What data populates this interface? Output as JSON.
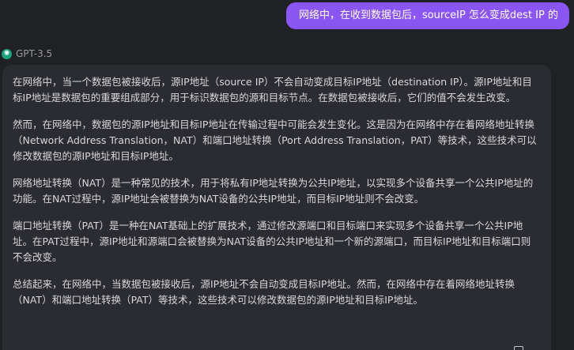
{
  "user_message": "网络中，在收到数据包后，sourceIP 怎么变成dest IP 的",
  "model": {
    "name": "GPT-3.5",
    "icon": "openai-icon"
  },
  "answer": {
    "paragraphs": [
      "在网络中，当一个数据包被接收后，源IP地址（source IP）不会自动变成目标IP地址（destination IP）。源IP地址和目标IP地址是数据包的重要组成部分，用于标识数据包的源和目标节点。在数据包被接收后，它们的值不会发生改变。",
      "然而，在网络中，数据包的源IP地址和目标IP地址在传输过程中可能会发生变化。这是因为在网络中存在着网络地址转换（Network Address Translation，NAT）和端口地址转换（Port Address Translation，PAT）等技术，这些技术可以修改数据包的源IP地址和目标IP地址。",
      "网络地址转换（NAT）是一种常见的技术，用于将私有IP地址转换为公共IP地址，以实现多个设备共享一个公共IP地址的功能。在NAT过程中，源IP地址会被替换为NAT设备的公共IP地址，而目标IP地址则不会改变。",
      "端口地址转换（PAT）是一种在NAT基础上的扩展技术，通过修改源端口和目标端口来实现多个设备共享一个公共IP地址。在PAT过程中，源IP地址和源端口会被替换为NAT设备的公共IP地址和一个新的源端口，而目标IP地址和目标端口则不会改变。",
      "总结起来，在网络中，当数据包被接收后，源IP地址不会自动变成目标IP地址。然而，在网络中存在着网络地址转换（NAT）和端口地址转换（PAT）等技术，这些技术可以修改数据包的源IP地址和目标IP地址。"
    ]
  },
  "colors": {
    "background": "#202123",
    "user_bubble": "#8b55f4",
    "answer_box": "#2b2c31",
    "model_icon": "#19a37f"
  }
}
